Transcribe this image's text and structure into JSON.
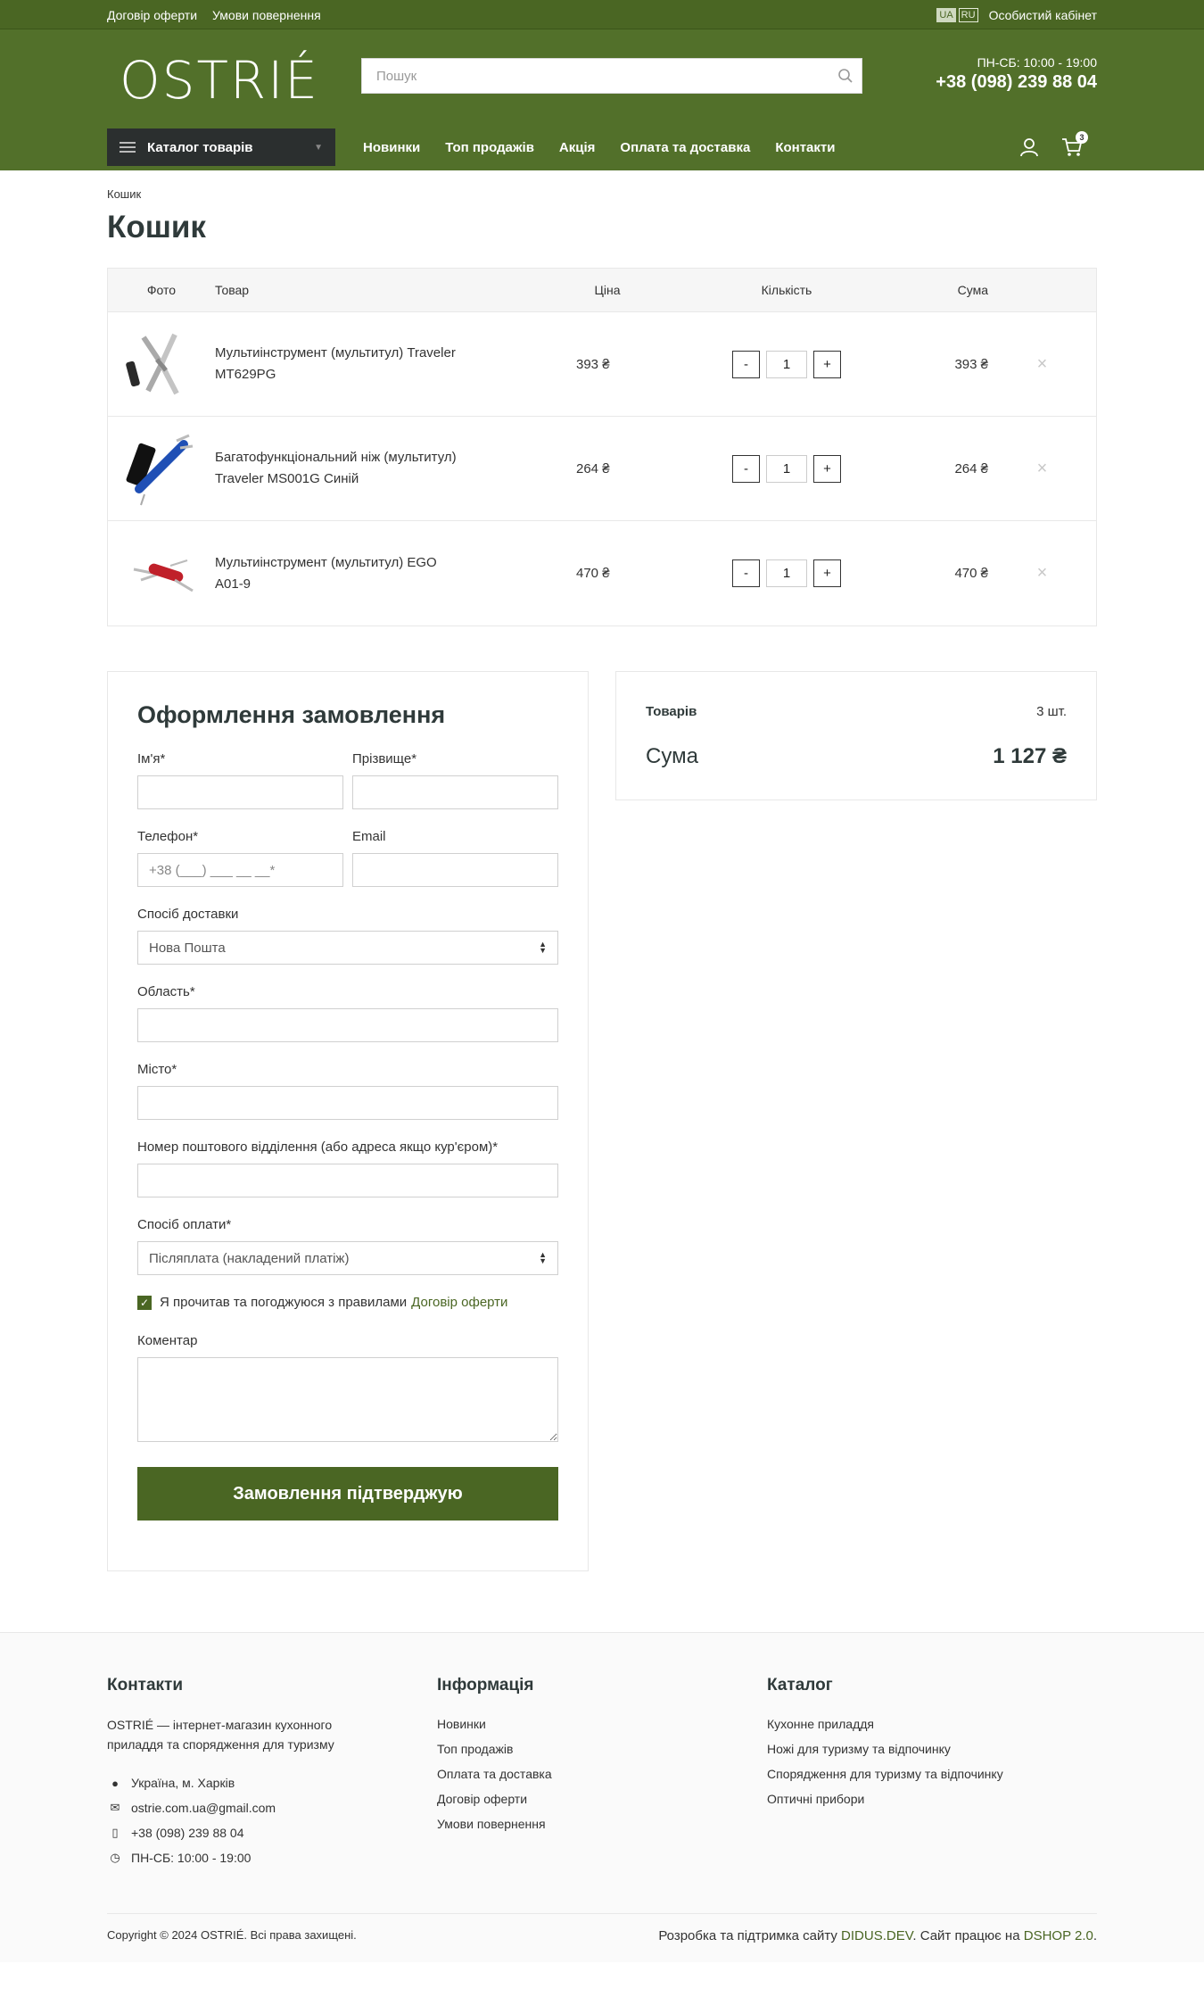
{
  "topbar": {
    "links": [
      "Договір оферти",
      "Умови повернення"
    ],
    "lang_active": "UA",
    "lang_alt": "RU",
    "cabinet": "Особистий кабінет"
  },
  "header": {
    "logo": "OSTRIÉ",
    "search_placeholder": "Пошук",
    "hours": "ПН-СБ: 10:00 - 19:00",
    "phone": "+38 (098) 239 88 04",
    "catalog_label": "Каталог товарів",
    "nav": [
      "Новинки",
      "Топ продажів",
      "Акція",
      "Оплата та доставка",
      "Контакти"
    ],
    "cart_count": "3",
    "colors": {
      "brand": "#4a6623",
      "header_bg": "#52702a"
    }
  },
  "breadcrumb": "Кошик",
  "title": "Кошик",
  "cart": {
    "headers": {
      "photo": "Фото",
      "product": "Товар",
      "price": "Ціна",
      "qty": "Кількість",
      "sum": "Сума"
    },
    "items": [
      {
        "name": "Мультиінструмент (мультитул) Traveler MT629PG",
        "price": "393 ₴",
        "qty": "1",
        "sum": "393 ₴",
        "thumb": "silver-multitool"
      },
      {
        "name": "Багатофункціональний ніж (мультитул) Traveler MS001G Синій",
        "price": "264 ₴",
        "qty": "1",
        "sum": "264 ₴",
        "thumb": "blue-multitool"
      },
      {
        "name": "Мультиінструмент (мультитул) EGO A01-9",
        "price": "470 ₴",
        "qty": "1",
        "sum": "470 ₴",
        "thumb": "red-pocket-knife"
      }
    ],
    "minus": "-",
    "plus": "+",
    "remove": "×"
  },
  "order": {
    "title": "Оформлення замовлення",
    "first_name": "Ім'я*",
    "last_name": "Прізвище*",
    "phone": "Телефон*",
    "phone_placeholder": "+38 (___) ___ __ __*",
    "email": "Email",
    "delivery": "Спосіб доставки",
    "delivery_value": "Нова Пошта",
    "region": "Область*",
    "city": "Місто*",
    "branch": "Номер поштового відділення (або адреса якщо кур'єром)*",
    "payment": "Спосіб оплати*",
    "payment_value": "Післяплата (накладений платіж)",
    "agree_text": "Я прочитав та погоджуюся з правилами",
    "agree_link": "Договір оферти",
    "comment": "Коментар",
    "submit": "Замовлення підтверджую"
  },
  "summary": {
    "items_label": "Товарів",
    "items_value": "3 шт.",
    "total_label": "Сума",
    "total_value": "1 127 ₴"
  },
  "footer": {
    "contacts_title": "Контакти",
    "about": "OSTRIÉ — інтернет-магазин кухонного приладдя та спорядження для туризму",
    "address": "Україна, м. Харків",
    "email": "ostrie.com.ua@gmail.com",
    "phone": "+38 (098) 239 88 04",
    "hours": "ПН-СБ: 10:00 - 19:00",
    "info_title": "Інформація",
    "info_links": [
      "Новинки",
      "Топ продажів",
      "Оплата та доставка",
      "Договір оферти",
      "Умови повернення"
    ],
    "catalog_title": "Каталог",
    "catalog_links": [
      "Кухонне приладдя",
      "Ножі для туризму та відпочинку",
      "Спорядження для туризму та відпочинку",
      "Оптичні прибори"
    ],
    "copyright": "Copyright © 2024 OSTRIÉ. Всі права захищені.",
    "dev_text": "Розробка та підтримка сайту",
    "dev_link": "DIDUS.DEV",
    "dev_text2": ". Сайт працює на",
    "dev_link2": "DSHOP 2.0",
    "dev_end": "."
  }
}
